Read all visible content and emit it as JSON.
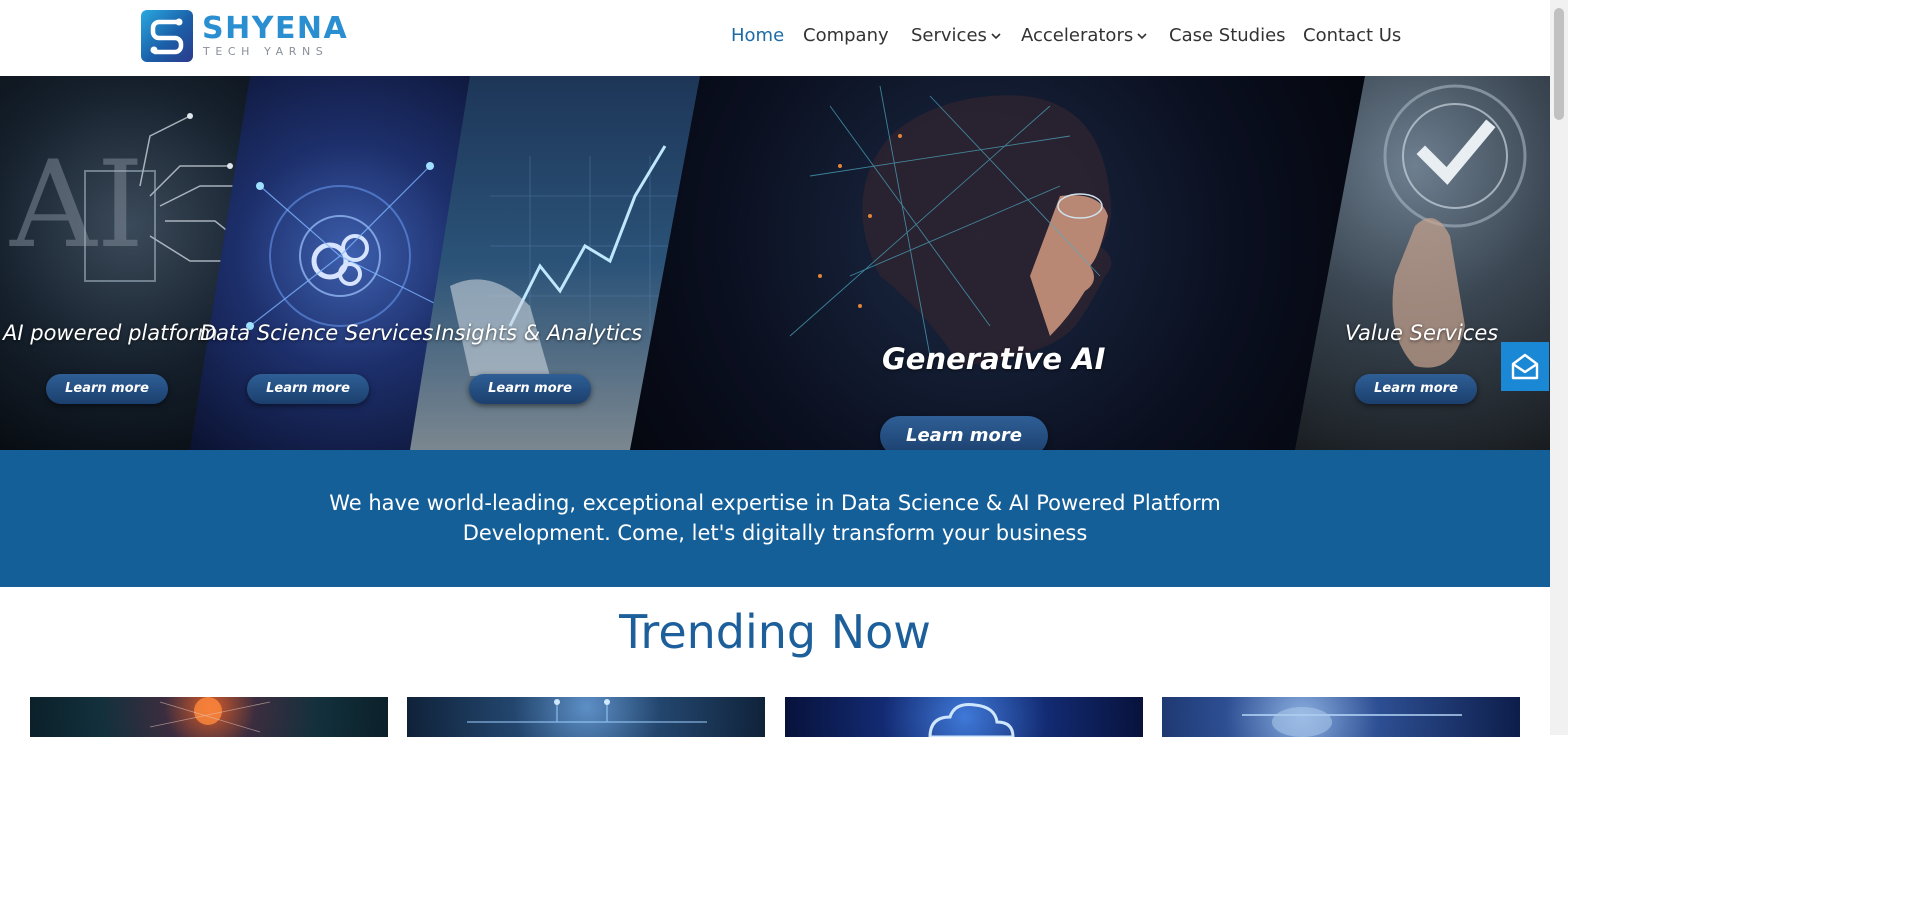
{
  "brand": {
    "name": "SHYENA",
    "tagline": "TECH YARNS",
    "colors": {
      "primary": "#1c6aa7",
      "band": "#155f99",
      "logo_blue": "#2a8fd0",
      "logo_indigo": "#3b4a9c"
    },
    "icon": "shyena-logo-icon"
  },
  "nav": {
    "items": [
      {
        "label": "Home",
        "active": true,
        "has_dropdown": false
      },
      {
        "label": "Company",
        "active": false,
        "has_dropdown": false
      },
      {
        "label": "Services",
        "active": false,
        "has_dropdown": true
      },
      {
        "label": "Accelerators",
        "active": false,
        "has_dropdown": true
      },
      {
        "label": "Case Studies",
        "active": false,
        "has_dropdown": false
      },
      {
        "label": "Contact Us",
        "active": false,
        "has_dropdown": false
      }
    ]
  },
  "hero": {
    "slides": [
      {
        "title": "AI powered platform",
        "button": "Learn more"
      },
      {
        "title": "Data Science Services",
        "button": "Learn more"
      },
      {
        "title": "Insights & Analytics",
        "button": "Learn more"
      },
      {
        "title": "Generative AI",
        "button": "Learn more"
      },
      {
        "title": "Value Services",
        "button": "Learn more"
      }
    ]
  },
  "banner": {
    "text": "We have world-leading, exceptional expertise in Data Science & AI Powered Platform Development. Come, let's digitally transform your business"
  },
  "trending": {
    "title": "Trending Now",
    "card_count": 4
  },
  "floating": {
    "icon": "mail-envelope-icon"
  }
}
